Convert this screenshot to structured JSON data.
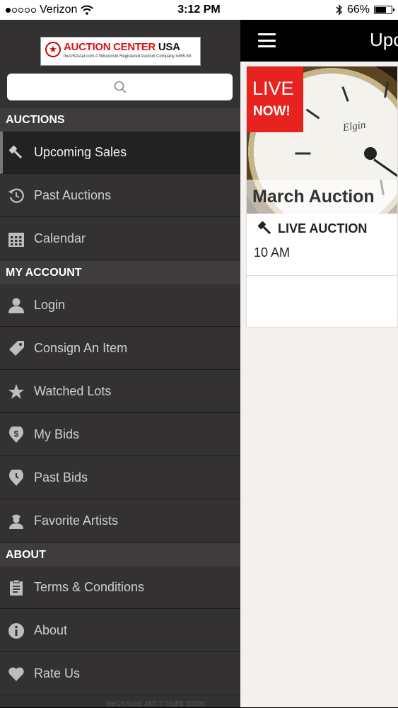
{
  "status_bar": {
    "carrier": "Verizon",
    "time": "3:12 PM",
    "battery_percent": "66%",
    "battery_level": 0.66
  },
  "logo": {
    "title_red": "AUCTION CENTER",
    "title_black": " USA",
    "subtitle": "theUSAstar.com  A Wisconsin Registered Auction Company #455-53"
  },
  "drawer": {
    "sections": [
      {
        "label": "AUCTIONS",
        "items": [
          {
            "label": "Upcoming Sales",
            "icon": "gavel-icon",
            "active": true
          },
          {
            "label": "Past Auctions",
            "icon": "history-icon"
          },
          {
            "label": "Calendar",
            "icon": "calendar-icon"
          }
        ]
      },
      {
        "label": "MY ACCOUNT",
        "items": [
          {
            "label": "Login",
            "icon": "user-icon"
          },
          {
            "label": "Consign An Item",
            "icon": "tag-icon"
          },
          {
            "label": "Watched Lots",
            "icon": "star-icon"
          },
          {
            "label": "My Bids",
            "icon": "dollar-pin-icon"
          },
          {
            "label": "Past Bids",
            "icon": "clock-pin-icon"
          },
          {
            "label": "Favorite Artists",
            "icon": "artist-icon"
          }
        ]
      },
      {
        "label": "ABOUT",
        "items": [
          {
            "label": "Terms & Conditions",
            "icon": "clipboard-icon"
          },
          {
            "label": "About",
            "icon": "info-icon"
          },
          {
            "label": "Rate Us",
            "icon": "heart-icon"
          }
        ]
      }
    ],
    "footer_text": "theUSAstar JAT-T-?SdfB 10000"
  },
  "main": {
    "header_title": "Upc",
    "card": {
      "badge_line1": "LIVE",
      "badge_line2": "NOW!",
      "watch_brand": "Elgin",
      "title": "March Auction",
      "type": "LIVE AUCTION",
      "time": "10 AM"
    }
  },
  "colors": {
    "drawer_bg": "#333131",
    "section_bg": "#3e3c3c",
    "live_red": "#e8231f",
    "content_bg": "#f4f0ee"
  }
}
